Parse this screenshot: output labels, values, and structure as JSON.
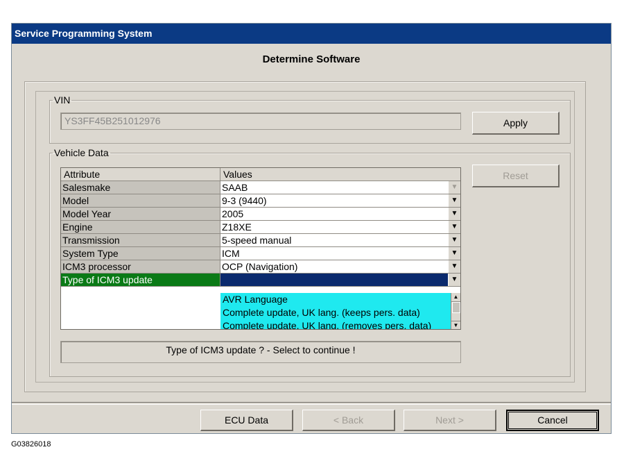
{
  "window": {
    "title": "Service Programming System"
  },
  "page": {
    "title": "Determine Software"
  },
  "vin_group": {
    "legend": "VIN",
    "value": "YS3FF45B251012976",
    "apply_label": "Apply"
  },
  "vehicle_group": {
    "legend": "Vehicle Data",
    "reset_label": "Reset",
    "columns": {
      "attribute": "Attribute",
      "values": "Values"
    },
    "rows": [
      {
        "attribute": "Salesmake",
        "value": "SAAB"
      },
      {
        "attribute": "Model",
        "value": "9-3 (9440)"
      },
      {
        "attribute": "Model Year",
        "value": "2005"
      },
      {
        "attribute": "Engine",
        "value": "Z18XE"
      },
      {
        "attribute": "Transmission",
        "value": "5-speed manual"
      },
      {
        "attribute": "System Type",
        "value": "ICM"
      },
      {
        "attribute": "ICM3 processor",
        "value": "OCP (Navigation)"
      },
      {
        "attribute": "Type of ICM3 update",
        "value": ""
      }
    ],
    "dropdown_options": [
      "AVR Language",
      "Complete update, UK lang. (keeps pers. data)",
      "Complete update, UK lang. (removes pers. data)"
    ]
  },
  "status": {
    "message": "Type of ICM3 update ? - Select to continue !"
  },
  "footer": {
    "ecu_data_label": "ECU Data",
    "back_label": "< Back",
    "next_label": "Next >",
    "cancel_label": "Cancel"
  },
  "caption": "G03826018",
  "colors": {
    "titlebar": "#0b3a84",
    "selected_attr": "#0a7a16",
    "selected_value": "#0b2a6e",
    "dropdown_bg": "#1fe9ef"
  }
}
